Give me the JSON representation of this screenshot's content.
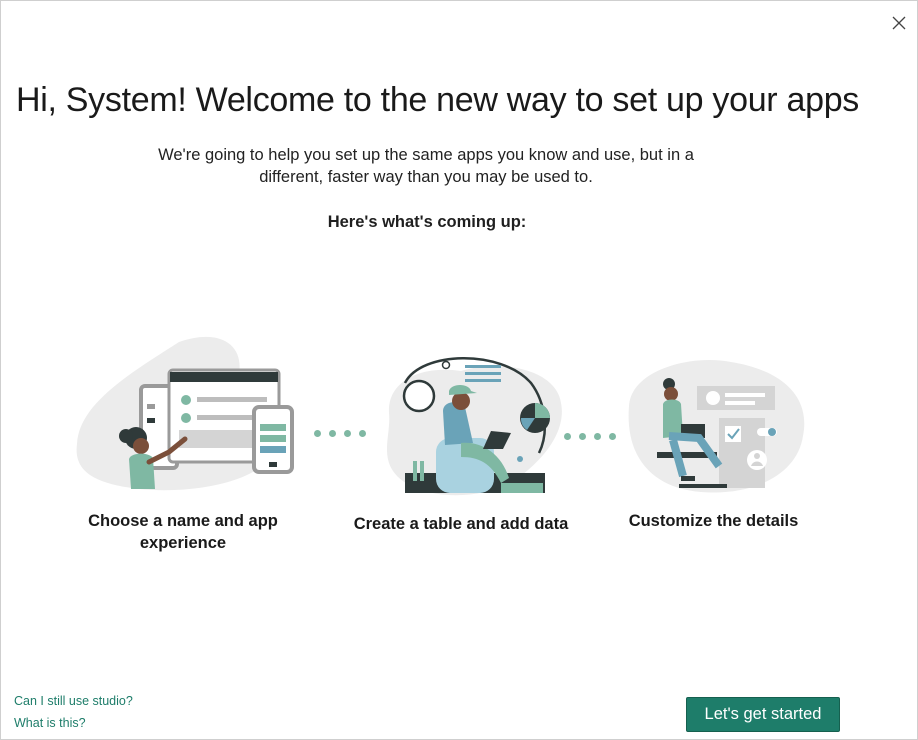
{
  "dialog": {
    "title": "Hi, System! Welcome to the new way to set up your apps",
    "intro": "We're going to help you set up the same apps you know and use, but in a different, faster way than you may be used to.",
    "coming_up": "Here's what's coming up:"
  },
  "steps": [
    {
      "label": "Choose a name and app experience",
      "icon": "tablet-person-illustration"
    },
    {
      "label": "Create a table and add data",
      "icon": "person-laptop-chart-illustration"
    },
    {
      "label": "Customize the details",
      "icon": "person-settings-illustration"
    }
  ],
  "links": {
    "studio": "Can I still use studio?",
    "what_is_this": "What is this?"
  },
  "primary_button": "Let's get started",
  "colors": {
    "accent": "#1e7d6a",
    "mint": "#7fb8a3",
    "dark": "#2f3a3a",
    "gray": "#e8e8e8"
  }
}
